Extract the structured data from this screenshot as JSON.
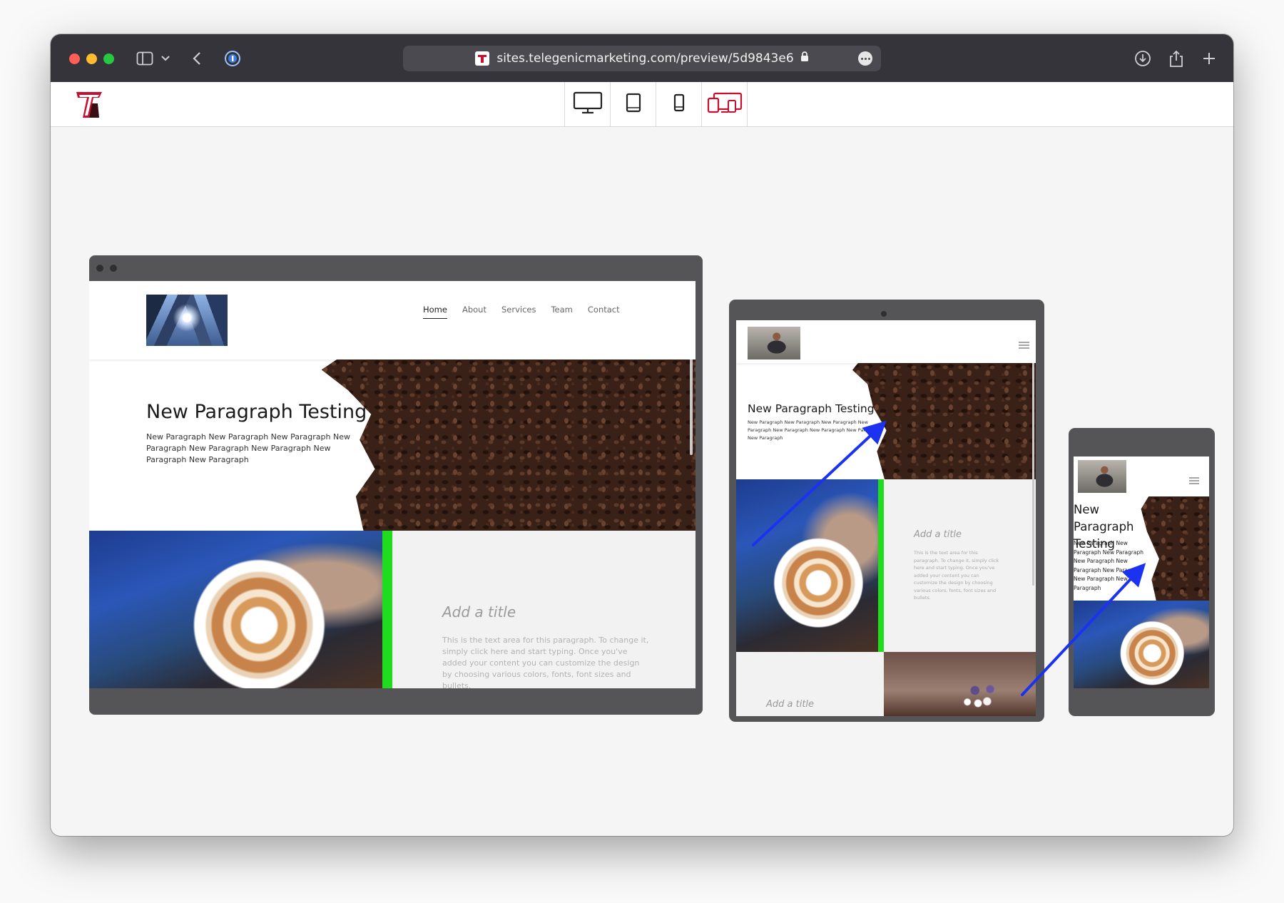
{
  "browser": {
    "url": "sites.telegenicmarketing.com/preview/5d9843e6",
    "lock_icon": "lock-icon",
    "more_icon": "ellipsis-circle-icon",
    "download_icon": "download-icon",
    "share_icon": "share-icon",
    "new_tab_icon": "plus-icon"
  },
  "app": {
    "logo_icon": "telegenic-logo-icon",
    "device_buttons": [
      {
        "name": "desktop",
        "icon": "monitor-icon",
        "active": false
      },
      {
        "name": "tablet",
        "icon": "tablet-icon",
        "active": false
      },
      {
        "name": "mobile",
        "icon": "phone-icon",
        "active": false
      },
      {
        "name": "all-devices",
        "icon": "multi-device-icon",
        "active": true
      }
    ]
  },
  "site": {
    "nav": [
      "Home",
      "About",
      "Services",
      "Team",
      "Contact"
    ],
    "active_nav": "Home",
    "hero_title": "New Paragraph Testing",
    "hero_body": "New Paragraph New Paragraph New Paragraph New Paragraph New Paragraph New Paragraph New Paragraph New Paragraph",
    "card_title": "Add a title",
    "card_body": "This is the text area for this paragraph. To change it, simply click here and start typing. Once you've added your content you can customize the design by choosing various colors, fonts, font sizes and bullets."
  },
  "colors": {
    "accent_red": "#c8102e",
    "green_divider": "#1fdc1f",
    "annotation_arrow": "#1b33f0"
  }
}
